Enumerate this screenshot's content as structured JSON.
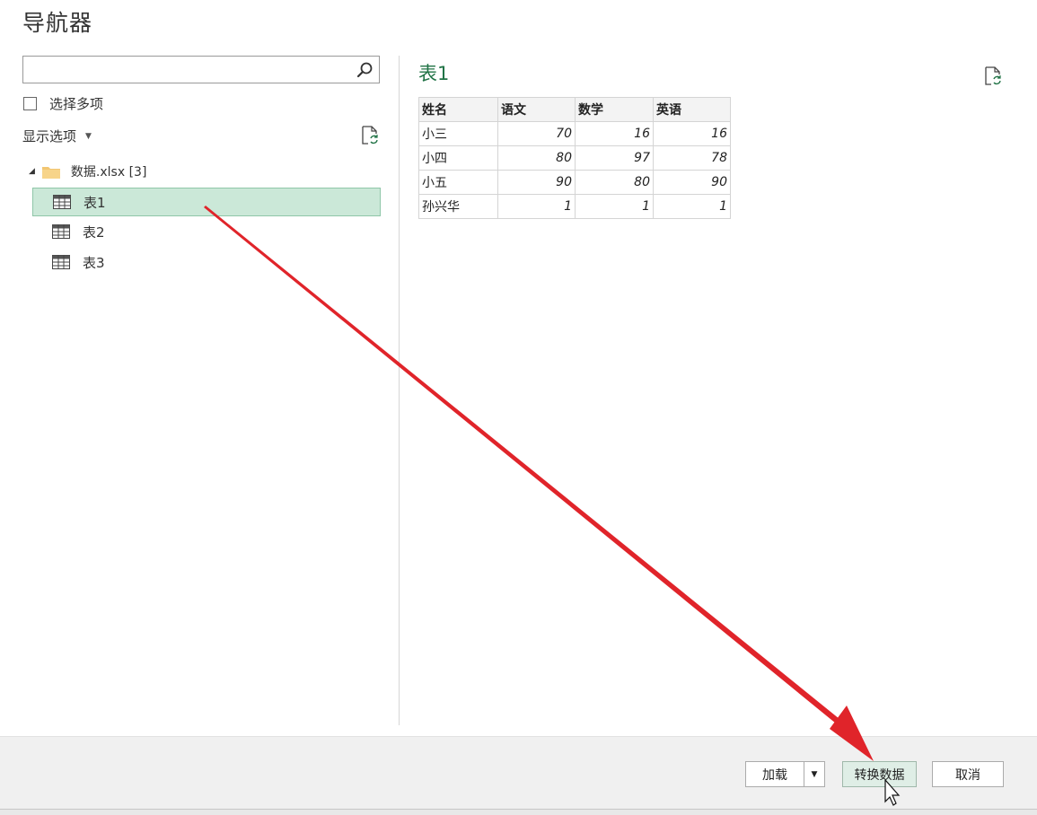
{
  "window": {
    "title": "导航器"
  },
  "left_pane": {
    "search": {
      "value": "",
      "placeholder": ""
    },
    "select_multiple_label": "选择多项",
    "display_options_label": "显示选项",
    "tree": {
      "root_label": "数据.xlsx [3]",
      "items": [
        {
          "label": "表1",
          "selected": true
        },
        {
          "label": "表2",
          "selected": false
        },
        {
          "label": "表3",
          "selected": false
        }
      ]
    }
  },
  "preview": {
    "title": "表1",
    "columns": [
      "姓名",
      "语文",
      "数学",
      "英语"
    ],
    "rows": [
      [
        "小三",
        "70",
        "16",
        "16"
      ],
      [
        "小四",
        "80",
        "97",
        "78"
      ],
      [
        "小五",
        "90",
        "80",
        "90"
      ],
      [
        "孙兴华",
        "1",
        "1",
        "1"
      ]
    ]
  },
  "footer": {
    "load_label": "加载",
    "transform_label": "转换数据",
    "cancel_label": "取消"
  },
  "colors": {
    "accent_green": "#217346",
    "selection_bg": "#cbe8d8",
    "annotation_arrow": "#e0242a"
  }
}
